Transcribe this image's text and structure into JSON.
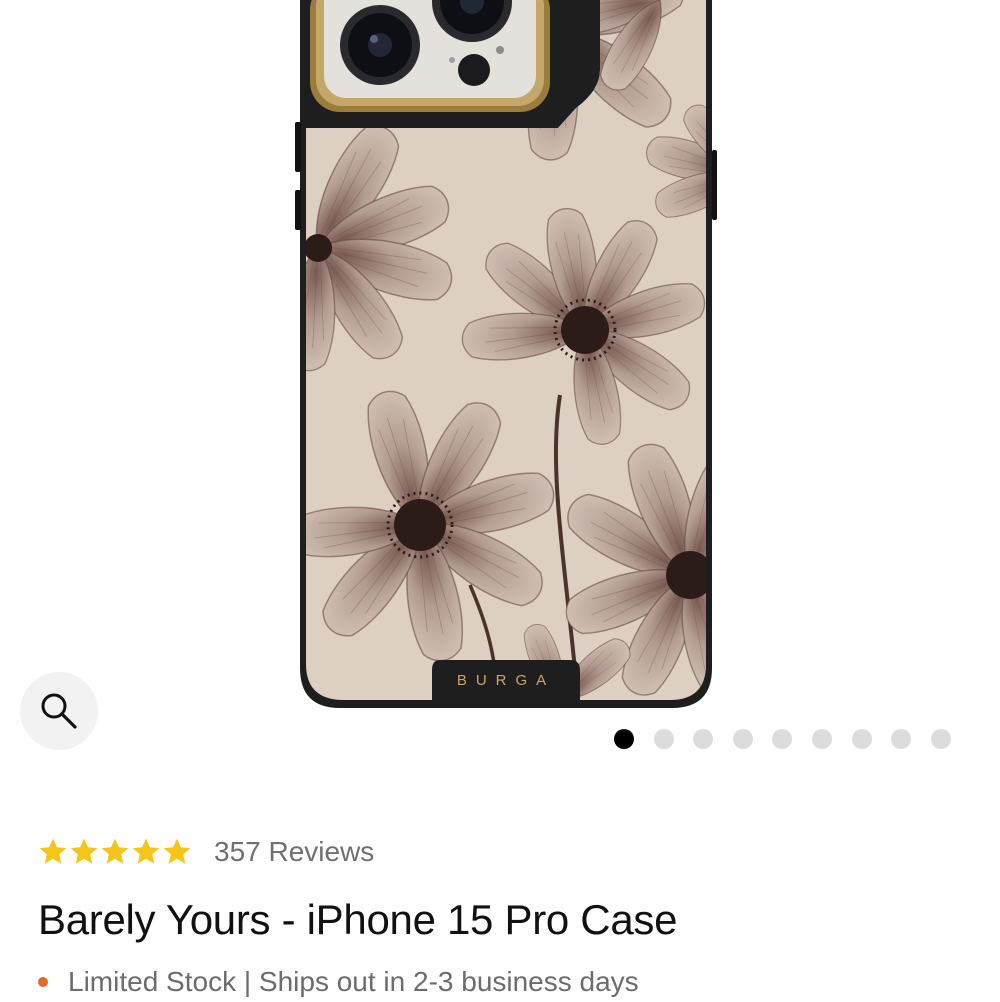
{
  "product": {
    "brand_mark": "BURGA",
    "rating": 5,
    "reviews_label": "357 Reviews",
    "title": "Barely Yours - iPhone 15 Pro Case",
    "stock_text": "Limited Stock | Ships out in 2-3 business days",
    "stock_color": "#e8692a"
  },
  "gallery": {
    "image_count": 9,
    "active_index": 0,
    "zoom_icon": "magnifier-icon"
  },
  "colors": {
    "star": "#f5c518",
    "case_frame": "#1e1e1e",
    "case_background": "#ddd0c3",
    "petal": "#b8a39a",
    "camera_ring": "#b09050"
  }
}
